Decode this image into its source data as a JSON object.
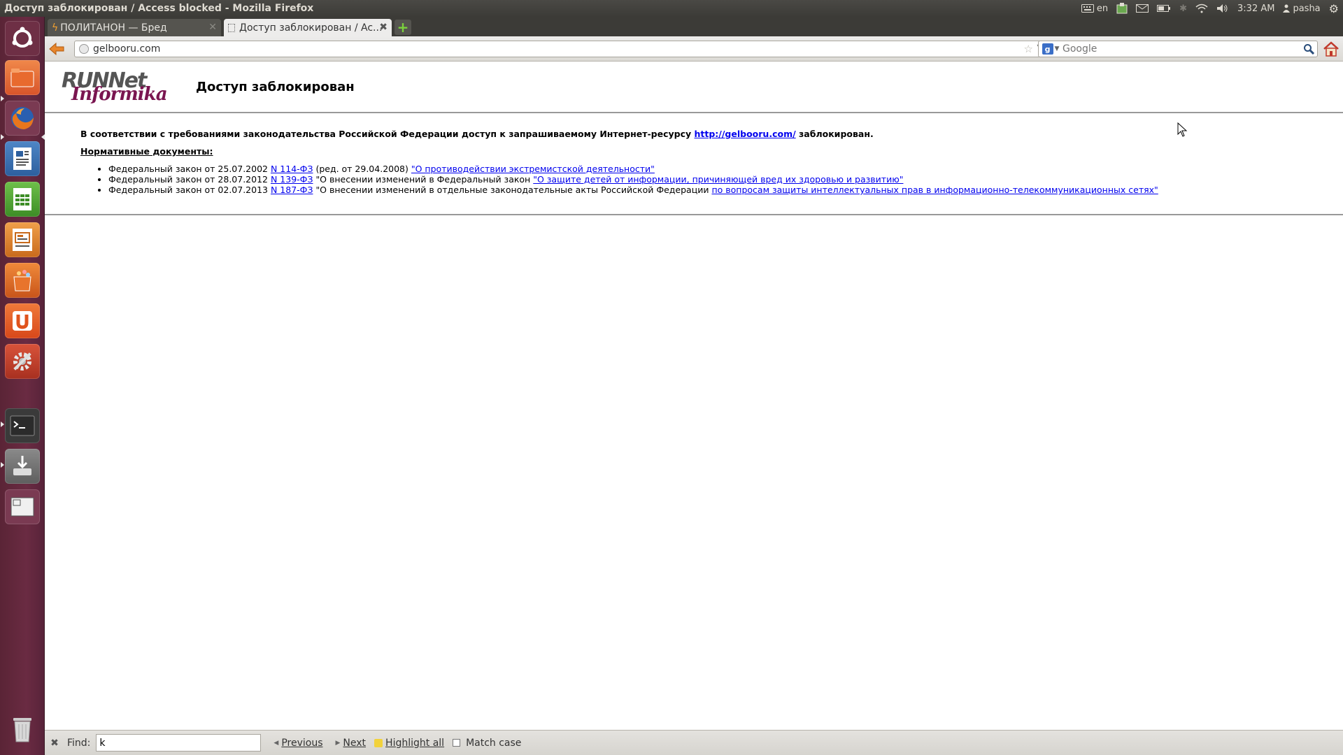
{
  "panel": {
    "window_title": "Доступ заблокирован / Access blocked - Mozilla Firefox",
    "keyboard_layout": "en",
    "time": "3:32 AM",
    "user": "pasha"
  },
  "tabs": [
    {
      "label": "ПОЛИТАНОН — Бред",
      "active": false
    },
    {
      "label": "Доступ заблокирован / Ac...",
      "active": true
    }
  ],
  "nav": {
    "url": "gelbooru.com",
    "search_placeholder": "Google"
  },
  "page": {
    "logo_line1": "RUNNet",
    "logo_line2": "Informika",
    "title": "Доступ заблокирован",
    "notice_prefix": "В соответствии с требованиями законодательства Российской Федерации доступ к запрашиваемому Интернет-ресурсу",
    "notice_link": "http://gelbooru.com/",
    "notice_suffix": "заблокирован.",
    "docs_heading": "Нормативные документы:",
    "docs": [
      {
        "prefix": "Федеральный закон от 25.07.2002",
        "law_link": "N 114-ФЗ",
        "middle": "(ред. от 29.04.2008)",
        "title_link": "\"О противодействии экстремистской деятельности\""
      },
      {
        "prefix": "Федеральный закон от 28.07.2012",
        "law_link": "N 139-ФЗ",
        "middle": "\"О внесении изменений в Федеральный закон",
        "title_link": "\"О защите детей от информации, причиняющей вред их здоровью и развитию\""
      },
      {
        "prefix": "Федеральный закон от 02.07.2013",
        "law_link": "N 187-ФЗ",
        "middle": "\"О внесении изменений в отдельные законодательные акты Российской Федерации",
        "title_link": "по вопросам защиты интеллектуальных прав в информационно-телекоммуникационных сетях\""
      }
    ]
  },
  "findbar": {
    "label": "Find:",
    "value": "k",
    "previous": "Previous",
    "next": "Next",
    "highlight_all": "Highlight all",
    "match_case": "Match case"
  },
  "launcher": {
    "items": [
      "ubuntu-dash-icon",
      "files-icon",
      "firefox-icon",
      "writer-icon",
      "calc-icon",
      "impress-icon",
      "software-center-icon",
      "ubuntu-one-icon",
      "system-settings-icon",
      "terminal-icon",
      "installer-icon",
      "workspace-switcher-icon",
      "trash-icon"
    ]
  }
}
